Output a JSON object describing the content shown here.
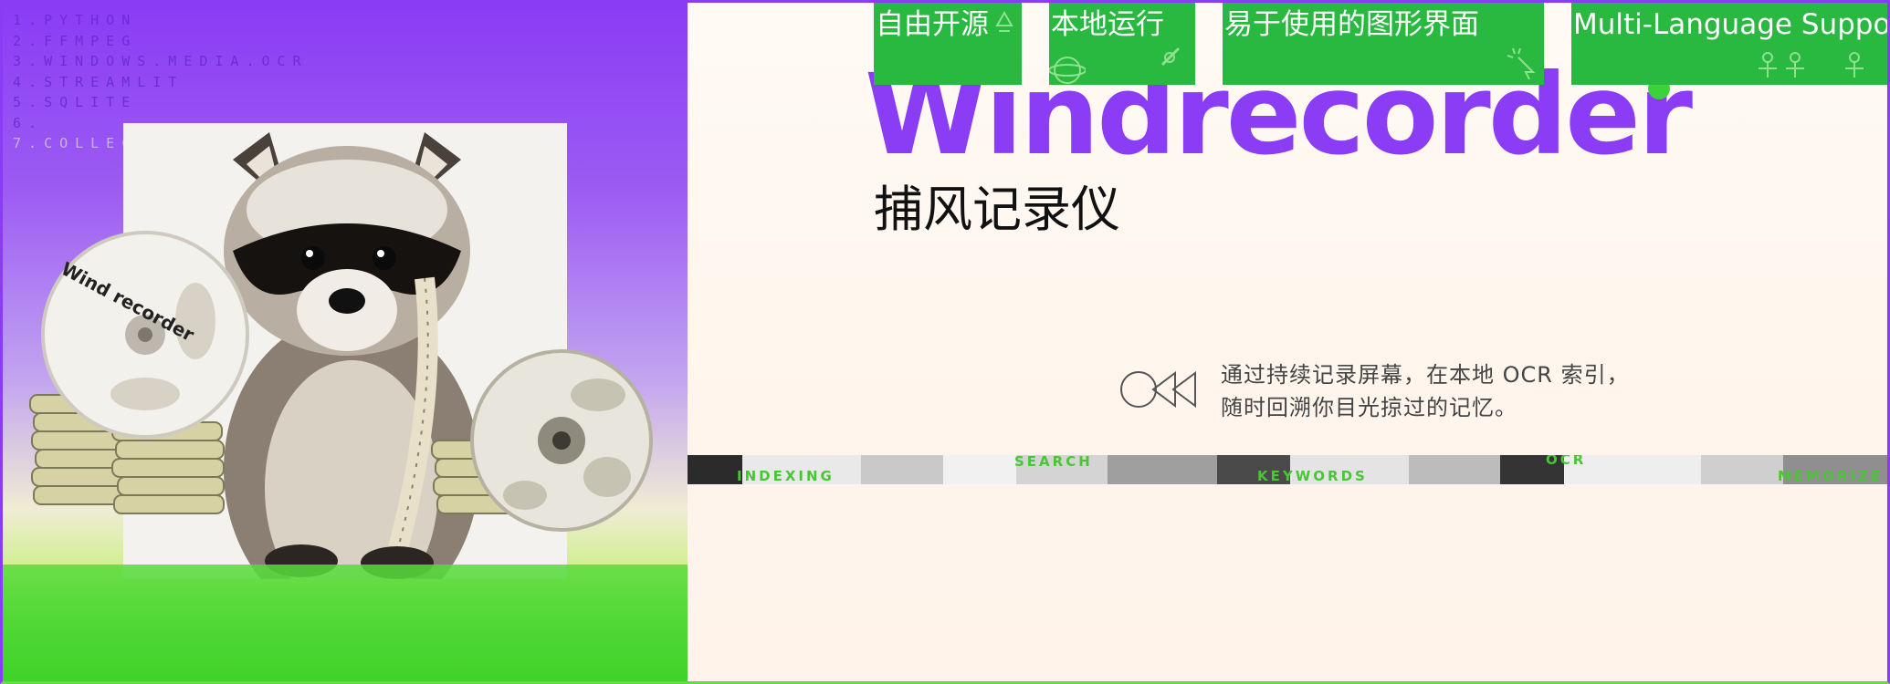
{
  "hero": {
    "tech_stack": [
      {
        "num": "1.",
        "name": "PYTHON"
      },
      {
        "num": "2.",
        "name": "FFMPEG"
      },
      {
        "num": "3.",
        "name": "WINDOWS.MEDIA.OCR"
      },
      {
        "num": "4.",
        "name": "STREAMLIT"
      },
      {
        "num": "5.",
        "name": "SQLITE"
      },
      {
        "num": "6.",
        "name": ""
      },
      {
        "num": "7.",
        "name": "COLLECTED"
      }
    ],
    "reel_label": "Wind recorder"
  },
  "brand": {
    "name": "Windrecorder",
    "subtitle": "捕风记录仪",
    "accent": "#8b3df5",
    "dot_color": "#3cd23a"
  },
  "tagline": {
    "line1": "通过持续记录屏幕，在本地 OCR 索引，",
    "line2": "随时回溯你目光掠过的记忆。"
  },
  "strip": {
    "words": [
      "INDEXING",
      "SEARCH",
      "KEYWORDS",
      "OCR",
      "MEMORIZE"
    ]
  },
  "features": [
    {
      "label": "自由开源",
      "icon": "recycle-icon"
    },
    {
      "label": "本地运行",
      "icon": "planet-icon"
    },
    {
      "label": "易于使用的图形界面",
      "icon": "cursor-click-icon"
    },
    {
      "label": "Multi-Language Support",
      "icon": "people-icon"
    }
  ],
  "colors": {
    "feature_bg": "#29b941",
    "hero_top": "#8a3cf5",
    "hero_bottom": "#4ed733"
  }
}
